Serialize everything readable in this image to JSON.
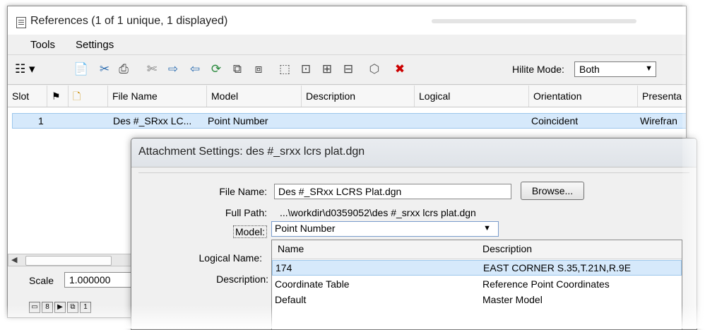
{
  "window": {
    "title": "References (1 of 1 unique, 1 displayed)"
  },
  "menu": {
    "items": [
      {
        "label": "Tools"
      },
      {
        "label": "Settings"
      }
    ]
  },
  "toolbar": {
    "hilite_label": "Hilite Mode:",
    "hilite_value": "Both"
  },
  "grid": {
    "columns": [
      "Slot",
      "File Name",
      "Model",
      "Description",
      "Logical",
      "Orientation",
      "Presenta"
    ],
    "rows": [
      {
        "slot": "1",
        "file_name": "Des #_SRxx LC...",
        "model": "Point Number",
        "orientation": "Coincident",
        "presentation": "Wirefran"
      }
    ]
  },
  "scale": {
    "label": "Scale",
    "value": "1.000000"
  },
  "dialog": {
    "title": "Attachment Settings: des #_srxx lcrs plat.dgn",
    "file_name_label": "File Name:",
    "file_name_value": "Des #_SRxx LCRS Plat.dgn",
    "browse_label": "Browse...",
    "full_path_label": "Full Path:",
    "full_path_value": "...\\workdir\\d0359052\\des #_srxx lcrs plat.dgn",
    "model_label": "Model:",
    "model_value": "Point Number",
    "logical_name_label": "Logical Name:",
    "description_label": "Description:",
    "dropdown": {
      "headers": {
        "name": "Name",
        "description": "Description"
      },
      "rows": [
        {
          "name": "174",
          "description": "EAST CORNER S.35,T.21N,R.9E"
        },
        {
          "name": "Coordinate Table",
          "description": "Reference Point Coordinates"
        },
        {
          "name": "Default",
          "description": "Master Model"
        }
      ]
    }
  }
}
